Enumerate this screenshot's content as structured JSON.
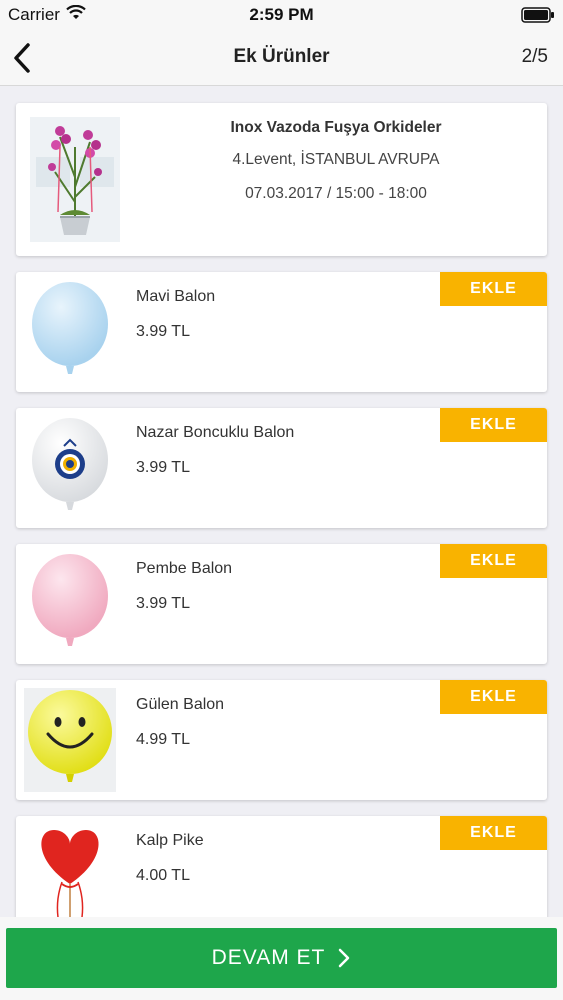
{
  "status_bar": {
    "carrier": "Carrier",
    "time": "2:59 PM"
  },
  "nav": {
    "title": "Ek Ürünler",
    "step": "2/5"
  },
  "order": {
    "title": "Inox Vazoda Fuşya Orkideler",
    "location": "4.Levent, İSTANBUL AVRUPA",
    "date": "07.03.2017 / 15:00 - 18:00"
  },
  "products": [
    {
      "name": "Mavi Balon",
      "price": "3.99 TL",
      "add_label": "EKLE"
    },
    {
      "name": "Nazar Boncuklu Balon",
      "price": "3.99 TL",
      "add_label": "EKLE"
    },
    {
      "name": "Pembe Balon",
      "price": "3.99 TL",
      "add_label": "EKLE"
    },
    {
      "name": "Gülen Balon",
      "price": "4.99 TL",
      "add_label": "EKLE"
    },
    {
      "name": "Kalp Pike",
      "price": "4.00 TL",
      "add_label": "EKLE"
    }
  ],
  "footer": {
    "continue_label": "DEVAM ET"
  },
  "colors": {
    "accent_add": "#f9b300",
    "accent_continue": "#1ea64b"
  }
}
